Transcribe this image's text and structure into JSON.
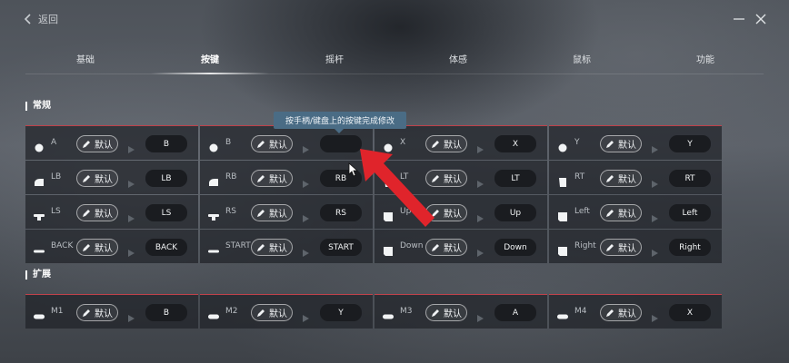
{
  "header": {
    "back_label": "返回"
  },
  "tabs": [
    {
      "label": "基础"
    },
    {
      "label": "按键"
    },
    {
      "label": "摇杆"
    },
    {
      "label": "体感"
    },
    {
      "label": "鼠标"
    },
    {
      "label": "功能"
    }
  ],
  "active_tab": "按键",
  "sections": {
    "general": {
      "title": "常规",
      "columns": [
        [
          {
            "key": "A",
            "icon": "circle-button-icon",
            "default_label": "默认",
            "value": "B"
          },
          {
            "key": "LB",
            "icon": "bumper-icon",
            "default_label": "默认",
            "value": "LB"
          },
          {
            "key": "LS",
            "icon": "stick-icon",
            "default_label": "默认",
            "value": "LS"
          },
          {
            "key": "BACK",
            "icon": "minus-button-icon",
            "default_label": "默认",
            "value": "BACK"
          }
        ],
        [
          {
            "key": "B",
            "icon": "circle-button-icon",
            "default_label": "默认",
            "value": ""
          },
          {
            "key": "RB",
            "icon": "bumper-icon",
            "default_label": "默认",
            "value": "RB"
          },
          {
            "key": "RS",
            "icon": "stick-icon",
            "default_label": "默认",
            "value": "RS"
          },
          {
            "key": "START",
            "icon": "minus-button-icon",
            "default_label": "默认",
            "value": "START"
          }
        ],
        [
          {
            "key": "X",
            "icon": "circle-button-icon",
            "default_label": "默认",
            "value": "X"
          },
          {
            "key": "LT",
            "icon": "trigger-icon",
            "default_label": "默认",
            "value": "LT"
          },
          {
            "key": "Up",
            "icon": "dpad-icon",
            "default_label": "默认",
            "value": "Up"
          },
          {
            "key": "Down",
            "icon": "dpad-icon",
            "default_label": "默认",
            "value": "Down"
          }
        ],
        [
          {
            "key": "Y",
            "icon": "circle-button-icon",
            "default_label": "默认",
            "value": "Y"
          },
          {
            "key": "RT",
            "icon": "trigger-icon",
            "default_label": "默认",
            "value": "RT"
          },
          {
            "key": "Left",
            "icon": "dpad-icon",
            "default_label": "默认",
            "value": "Left"
          },
          {
            "key": "Right",
            "icon": "dpad-icon",
            "default_label": "默认",
            "value": "Right"
          }
        ]
      ]
    },
    "extended": {
      "title": "扩展",
      "columns": [
        [
          {
            "key": "M1",
            "icon": "paddle-icon",
            "default_label": "默认",
            "value": "B"
          }
        ],
        [
          {
            "key": "M2",
            "icon": "paddle-icon",
            "default_label": "默认",
            "value": "Y"
          }
        ],
        [
          {
            "key": "M3",
            "icon": "paddle-icon",
            "default_label": "默认",
            "value": "A"
          }
        ],
        [
          {
            "key": "M4",
            "icon": "paddle-icon",
            "default_label": "默认",
            "value": "X"
          }
        ]
      ]
    }
  },
  "tooltip": {
    "text": "按手柄/键盘上的按键完成修改"
  },
  "colors": {
    "accent_line": "#c0414a",
    "tooltip_bg": "#4a6c85",
    "annotation_arrow": "#e0242b"
  }
}
